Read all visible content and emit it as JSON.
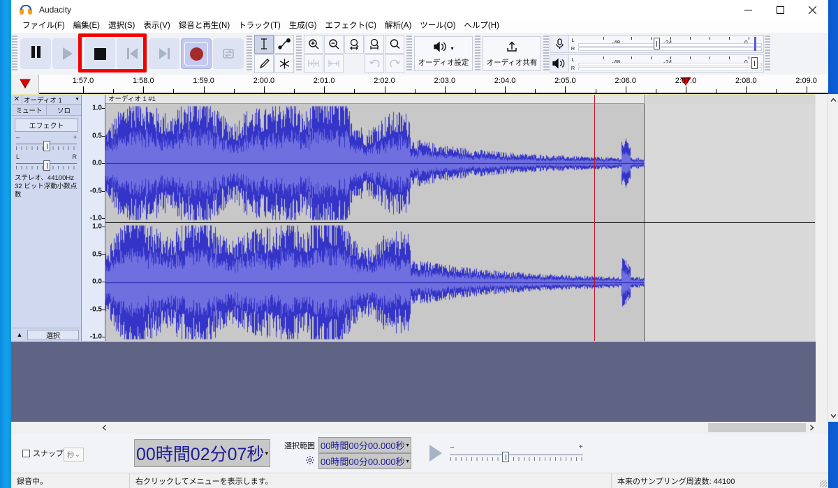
{
  "window": {
    "title": "Audacity",
    "icon": "audacity-logo-icon",
    "minimize": "–",
    "maximize": "□",
    "close": "✕"
  },
  "menubar": {
    "items": [
      {
        "label": "ファイル(F)"
      },
      {
        "label": "編集(E)"
      },
      {
        "label": "選択(S)"
      },
      {
        "label": "表示(V)"
      },
      {
        "label": "録音と再生(N)"
      },
      {
        "label": "トラック(T)"
      },
      {
        "label": "生成(G)"
      },
      {
        "label": "エフェクト(C)"
      },
      {
        "label": "解析(A)"
      },
      {
        "label": "ツール(O)"
      },
      {
        "label": "ヘルプ(H)"
      }
    ]
  },
  "transport": {
    "buttons": [
      {
        "name": "pause-button",
        "icon": "pause-icon",
        "state": "enabled"
      },
      {
        "name": "play-button",
        "icon": "play-icon",
        "state": "disabled"
      },
      {
        "name": "stop-button",
        "icon": "stop-icon",
        "state": "enabled"
      },
      {
        "name": "skip-start-button",
        "icon": "skip-to-start-icon",
        "state": "disabled"
      },
      {
        "name": "skip-end-button",
        "icon": "skip-to-end-icon",
        "state": "disabled"
      },
      {
        "name": "record-button",
        "icon": "record-icon",
        "state": "active"
      },
      {
        "name": "loop-button",
        "icon": "loop-icon",
        "state": "disabled"
      }
    ],
    "highlight": {
      "target": "stop-button",
      "color": "#f50000"
    }
  },
  "tools": {
    "items": [
      {
        "name": "selection-tool",
        "icon": "i-beam-icon",
        "active": true
      },
      {
        "name": "envelope-tool",
        "icon": "envelope-icon",
        "active": false
      },
      {
        "name": "draw-tool",
        "icon": "pencil-icon",
        "active": false
      },
      {
        "name": "multi-tool",
        "icon": "asterisk-icon",
        "active": false
      }
    ]
  },
  "edit_toolbar": {
    "items": [
      {
        "name": "zoom-in-button",
        "icon": "zoom-in-icon"
      },
      {
        "name": "zoom-out-button",
        "icon": "zoom-out-icon"
      },
      {
        "name": "fit-selection-button",
        "icon": "fit-selection-icon"
      },
      {
        "name": "fit-project-button",
        "icon": "fit-project-icon"
      },
      {
        "name": "zoom-toggle-button",
        "icon": "zoom-toggle-icon"
      },
      {
        "name": "trim-audio-button",
        "icon": "trim-outside-icon"
      },
      {
        "name": "silence-audio-button",
        "icon": "silence-selection-icon"
      },
      {
        "name": "undo-button",
        "icon": "undo-icon"
      },
      {
        "name": "redo-button",
        "icon": "redo-icon"
      }
    ]
  },
  "audio_setup": {
    "label": "オーディオ設定",
    "icon": "speaker-icon",
    "caret": "▾"
  },
  "audio_share": {
    "label": "オーディオ共有",
    "icon": "upload-icon"
  },
  "meters": {
    "record": {
      "icon": "microphone-icon",
      "left_label": "L",
      "right_label": "R",
      "scale": [
        "-48",
        "-24",
        "0"
      ]
    },
    "play": {
      "icon": "speaker-output-icon",
      "left_label": "L",
      "right_label": "R",
      "scale": [
        "-48",
        "-24",
        "0"
      ]
    }
  },
  "timeline": {
    "pin_icon": "pinned-play-head-icon",
    "labels": [
      "1:57.0",
      "1:58.0",
      "1:59.0",
      "2:00.0",
      "2:01.0",
      "2:02.0",
      "2:03.0",
      "2:04.0",
      "2:05.0",
      "2:06.0",
      "2:07.0",
      "2:08.0",
      "2:09.0"
    ],
    "playhead_position": "2:07.0",
    "playhead_color": "#e00000"
  },
  "track": {
    "close_icon": "✕",
    "name": "オーディオ 1",
    "name_caret": "▼",
    "mute": "ミュート",
    "solo": "ソロ",
    "effects": "エフェクト",
    "gain_slider": {
      "minus": "–",
      "plus": "+"
    },
    "pan_slider": {
      "left": "L",
      "right": "R"
    },
    "info_line1": "ステレオ、44100Hz",
    "info_line2": "32 ビット浮動小数点数",
    "collapse_icon": "▲",
    "select_button": "選択",
    "clip_title": "オーディオ 1 #1",
    "vertical_ruler": [
      "1.0",
      "0.5",
      "0.0",
      "-0.5",
      "-1.0"
    ],
    "waveform_color_outer": "#3434c8",
    "waveform_color_inner": "#6f6fe0",
    "clip_background": "#c8c8c8",
    "record_cursor_color": "#c01028"
  },
  "bottom": {
    "snap_label": "スナップ",
    "snap_unit": "秒",
    "snap_caret": "⌄",
    "audio_position": "00時間02分07秒",
    "audio_position_caret": "▾",
    "selection_label": "選択範囲",
    "selection_settings_icon": "gear-icon",
    "selection_start": "00時間00分00.000秒",
    "selection_end": "00時間00分00.000秒",
    "selection_caret": "▾",
    "play_at_speed_icon": "play-at-speed-icon",
    "speed_minus": "–",
    "speed_plus": "+"
  },
  "statusbar": {
    "left": "録音中。",
    "center": "右クリックしてメニューを表示します。",
    "right": "本来のサンプリング周波数: 44100"
  },
  "scrollbars": {
    "v_up_icon": "chevron-up-icon",
    "v_down_icon": "chevron-down-icon",
    "h_left_icon": "chevron-left-icon",
    "h_right_icon": "chevron-right-icon"
  }
}
